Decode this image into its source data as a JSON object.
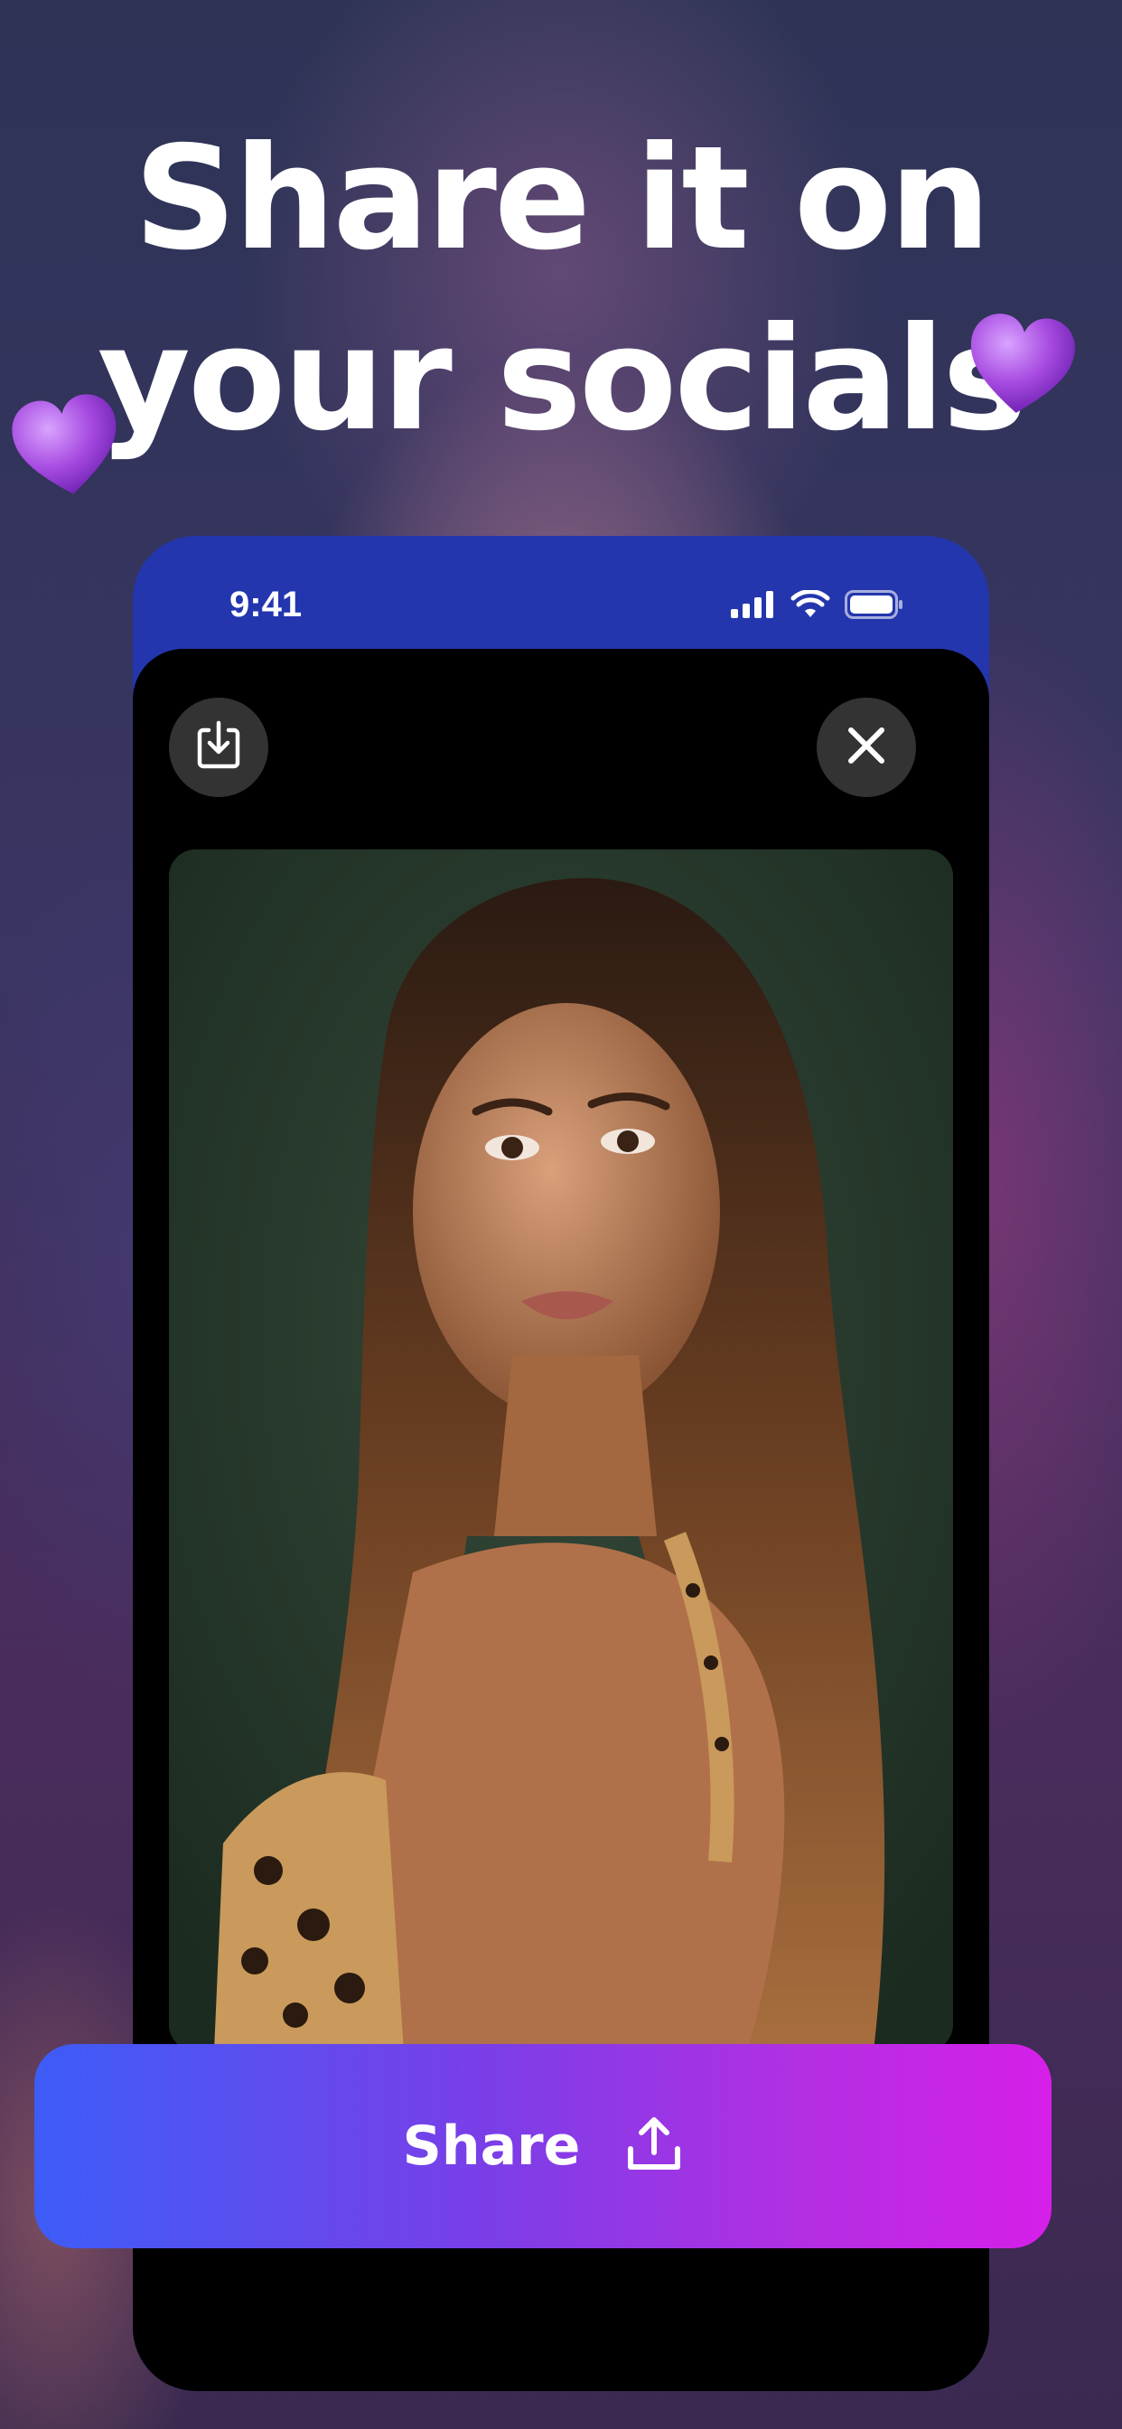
{
  "headline": {
    "line1": "Share it on",
    "line2": "your socials"
  },
  "status_bar": {
    "time": "9:41"
  },
  "actions": {
    "share_label": "Share"
  },
  "icons": {
    "heart": "purple-heart-icon",
    "download": "download-icon",
    "close": "close-icon",
    "share": "share-upload-icon",
    "signal": "cellular-signal-icon",
    "wifi": "wifi-icon",
    "battery": "battery-icon"
  },
  "colors": {
    "phone_frame": "#2436ad",
    "share_gradient_start": "#3d5cf7",
    "share_gradient_end": "#d61fe8",
    "heart": "#a64ae0"
  }
}
